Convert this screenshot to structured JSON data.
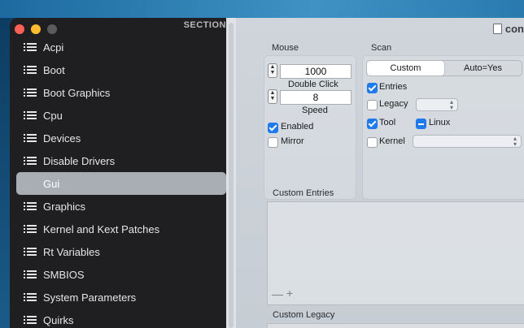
{
  "sidebar": {
    "header": "SECTION",
    "items": [
      {
        "label": "Acpi",
        "selected": false
      },
      {
        "label": "Boot",
        "selected": false
      },
      {
        "label": "Boot Graphics",
        "selected": false
      },
      {
        "label": "Cpu",
        "selected": false
      },
      {
        "label": "Devices",
        "selected": false
      },
      {
        "label": "Disable Drivers",
        "selected": false
      },
      {
        "label": "Gui",
        "selected": true
      },
      {
        "label": "Graphics",
        "selected": false
      },
      {
        "label": "Kernel and Kext Patches",
        "selected": false
      },
      {
        "label": "Rt Variables",
        "selected": false
      },
      {
        "label": "SMBIOS",
        "selected": false
      },
      {
        "label": "System Parameters",
        "selected": false
      },
      {
        "label": "Quirks",
        "selected": false
      }
    ]
  },
  "window": {
    "title": "con"
  },
  "mouse": {
    "label": "Mouse",
    "double_click_value": "1000",
    "double_click_label": "Double Click",
    "speed_value": "8",
    "speed_label": "Speed",
    "enabled_label": "Enabled",
    "enabled_checked": true,
    "mirror_label": "Mirror",
    "mirror_checked": false
  },
  "scan": {
    "label": "Scan",
    "segments": [
      "Custom",
      "Auto=Yes"
    ],
    "selected_segment": "Custom",
    "entries_label": "Entries",
    "entries_checked": true,
    "legacy_label": "Legacy",
    "legacy_checked": false,
    "tool_label": "Tool",
    "tool_checked": true,
    "linux_label": "Linux",
    "linux_state": "mixed",
    "kernel_label": "Kernel",
    "kernel_checked": false
  },
  "custom_entries": {
    "label": "Custom Entries",
    "remove_symbol": "—",
    "add_symbol": "+"
  },
  "custom_legacy": {
    "label": "Custom Legacy"
  },
  "colors": {
    "sidebar_bg": "#1f1f21",
    "selected_item": "#a9aeb5",
    "accent": "#1f7aeb",
    "close": "#fe5f57",
    "minimize": "#febc2e"
  }
}
